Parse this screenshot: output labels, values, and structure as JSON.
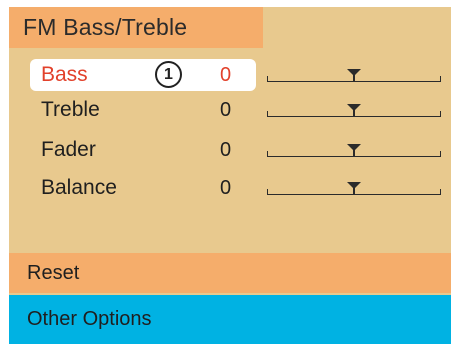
{
  "screen": {
    "title": "FM Bass/Treble",
    "colors": {
      "panel_background": "#e8c98e",
      "title_bar": "#f5ad6b",
      "reset_bar": "#f5ad6b",
      "options_bar": "#00b2e3",
      "selected_text": "#e2412b"
    }
  },
  "settings": [
    {
      "label": "Bass",
      "value": "0",
      "level": 0.5,
      "selected": true
    },
    {
      "label": "Treble",
      "value": "0",
      "level": 0.5,
      "selected": false
    },
    {
      "label": "Fader",
      "value": "0",
      "level": 0.5,
      "selected": false
    },
    {
      "label": "Balance",
      "value": "0",
      "level": 0.5,
      "selected": false
    }
  ],
  "callout": {
    "number": "1",
    "icon": "numbered-callout-icon"
  },
  "actions": {
    "reset_label": "Reset",
    "other_options_label": "Other Options"
  }
}
